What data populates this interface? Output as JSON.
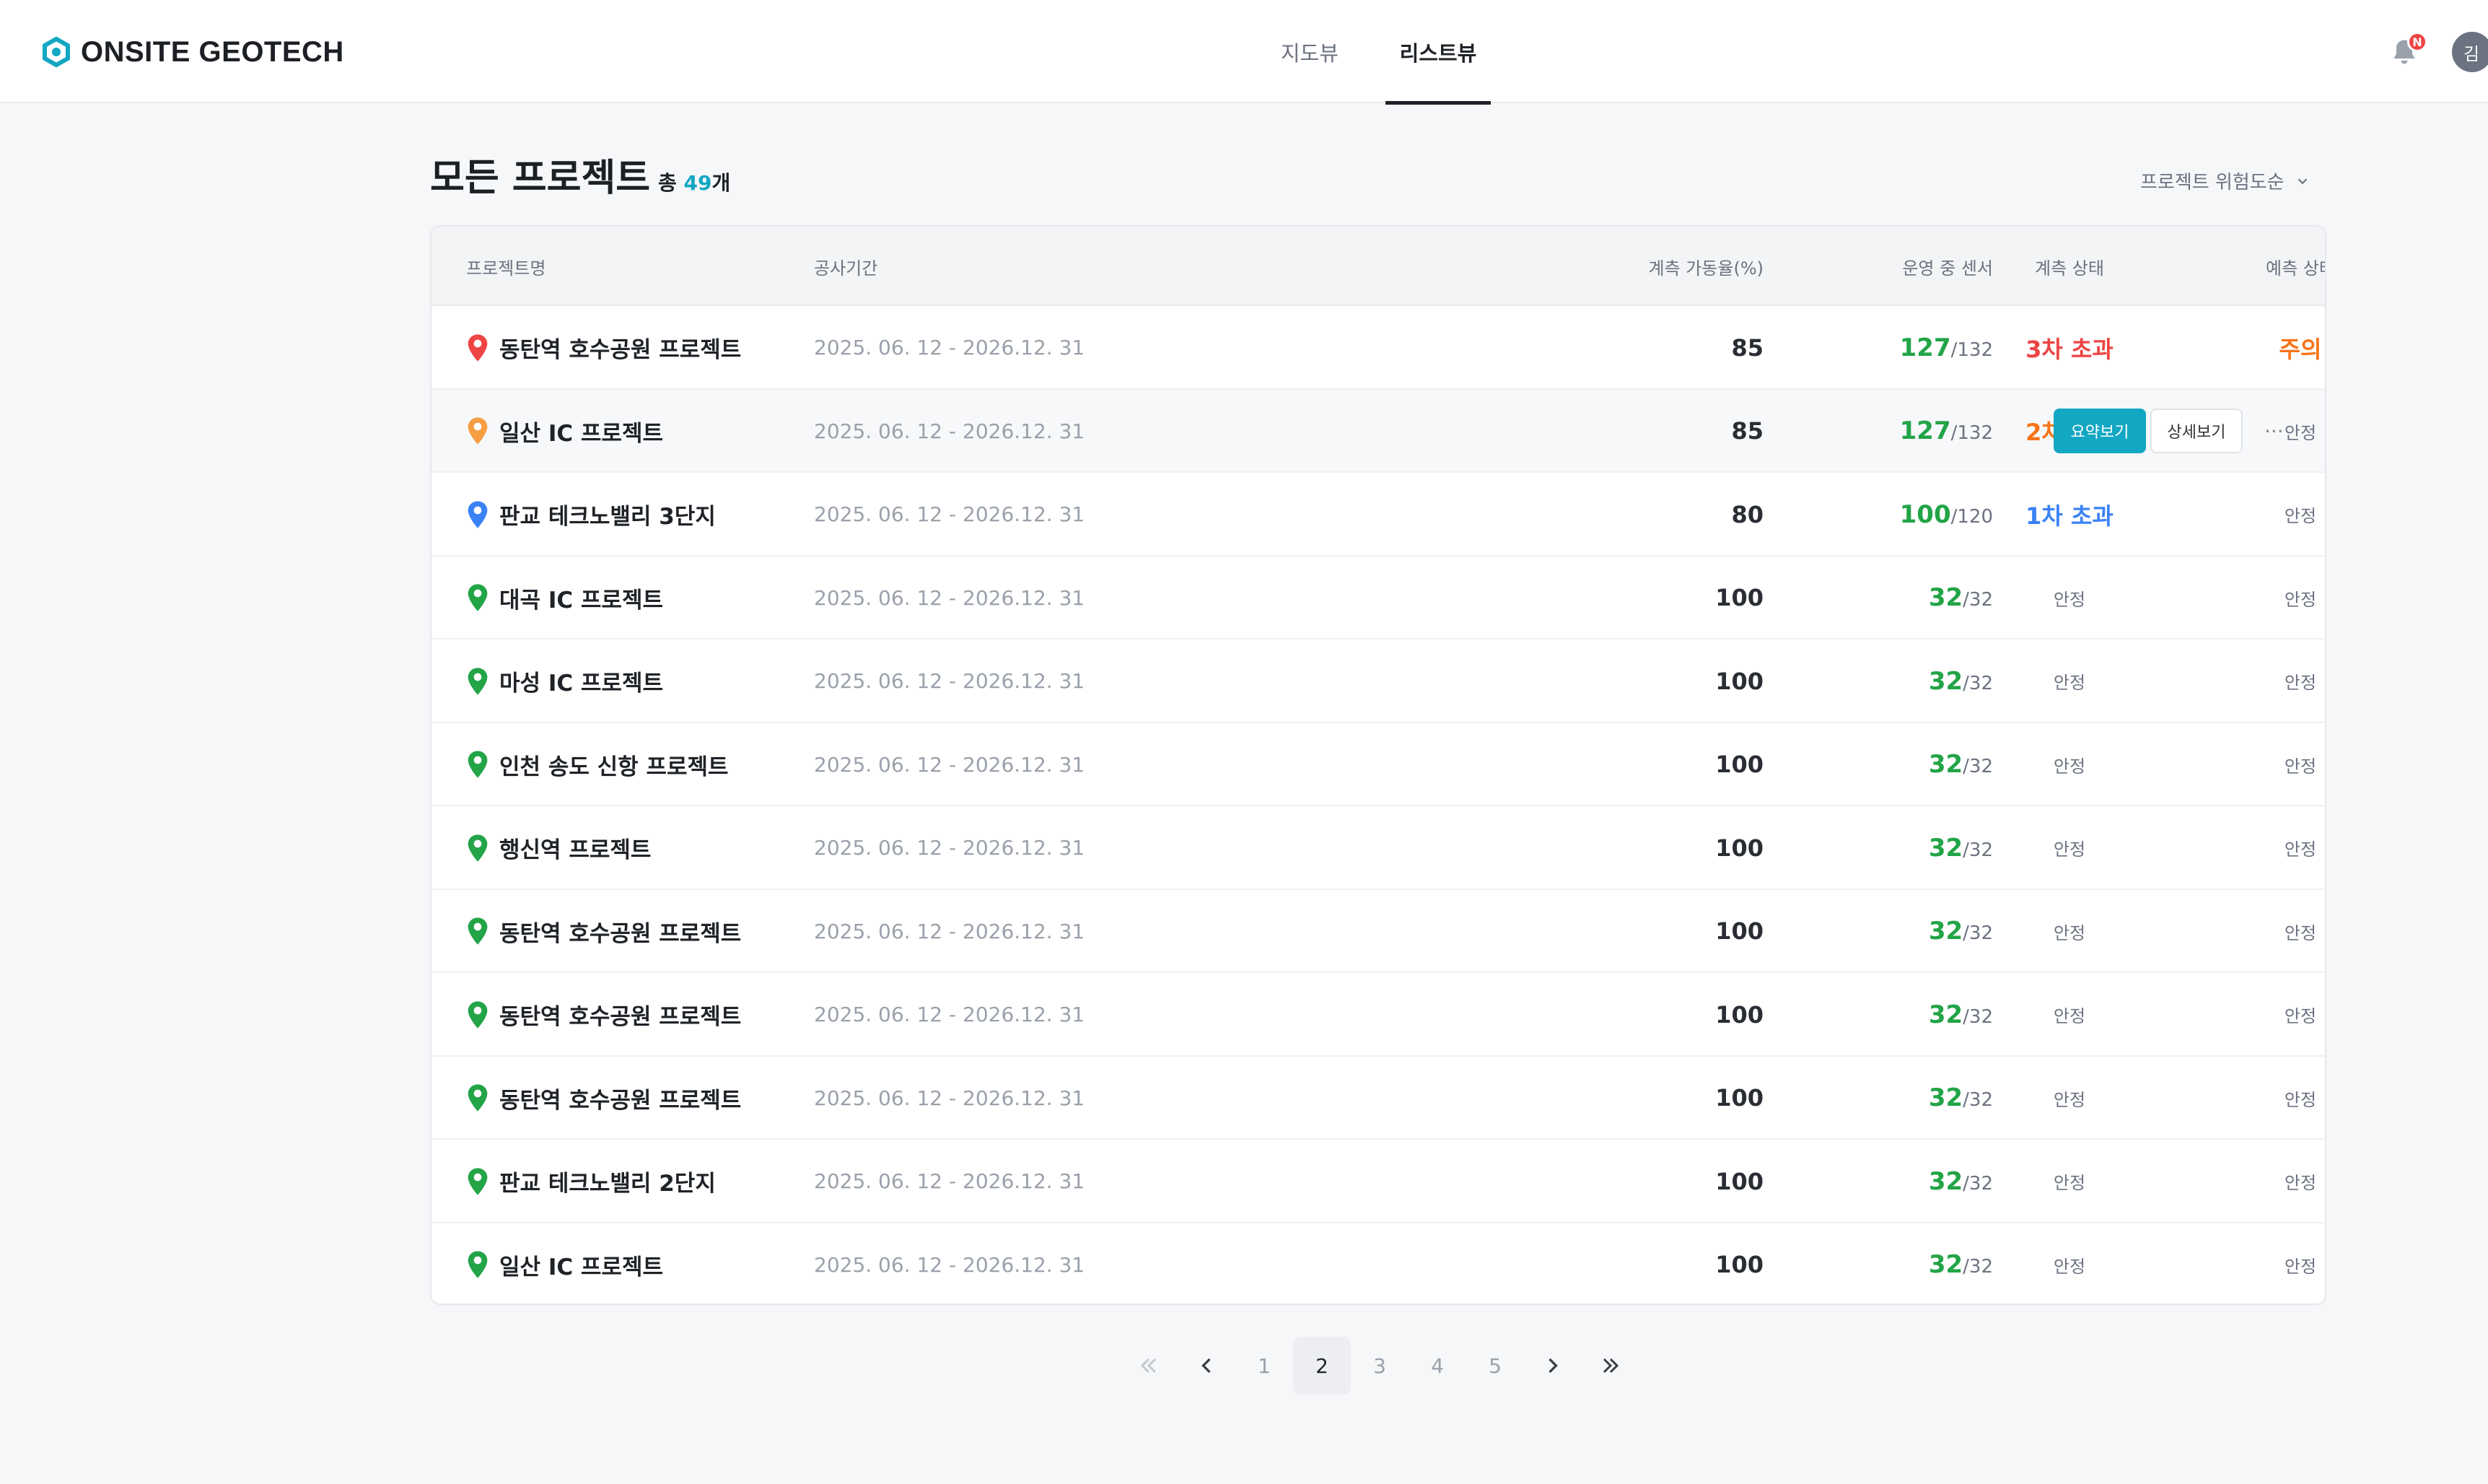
{
  "header": {
    "brand": "ONSITE GEOTECH",
    "tabs": [
      {
        "label": "지도뷰",
        "active": false
      },
      {
        "label": "리스트뷰",
        "active": true
      }
    ],
    "notification_badge": "N",
    "avatar_initial": "김"
  },
  "page": {
    "title": "모든 프로젝트",
    "total_prefix": "총 ",
    "total_count": "49",
    "total_suffix": "개",
    "sort_label": "프로젝트 위험도순"
  },
  "table": {
    "columns": [
      "프로젝트명",
      "공사기간",
      "계측 가동율(%)",
      "운영 중 센서",
      "계측 상태",
      "예측 상태"
    ],
    "rows": [
      {
        "name": "동탄역 호수공원 프로젝트",
        "pin_color": "#ef4444",
        "period": "2025. 06. 12 - 2026.12. 31",
        "rate": "85",
        "sensor_active": "127",
        "sensor_total": "/132",
        "measure_status": "3차 초과",
        "measure_color": "#ef4444",
        "predict_status": "주의",
        "predict_color": "#f97316"
      },
      {
        "name": "일산 IC 프로젝트",
        "pin_color": "#f59e42",
        "period": "2025. 06. 12 - 2026.12. 31",
        "rate": "85",
        "sensor_active": "127",
        "sensor_total": "/132",
        "measure_status": "2차 초과",
        "measure_color": "#f97316",
        "predict_status": "안정",
        "predict_color": "#6b7280"
      },
      {
        "name": "판교 테크노밸리 3단지",
        "pin_color": "#3b82f6",
        "period": "2025. 06. 12 - 2026.12. 31",
        "rate": "80",
        "sensor_active": "100",
        "sensor_total": "/120",
        "measure_status": "1차 초과",
        "measure_color": "#3b82f6",
        "predict_status": "안정",
        "predict_color": "#6b7280"
      },
      {
        "name": "대곡 IC 프로젝트",
        "pin_color": "#22a447",
        "period": "2025. 06. 12 - 2026.12. 31",
        "rate": "100",
        "sensor_active": "32",
        "sensor_total": "/32",
        "measure_status": "안정",
        "measure_color": "#6b7280",
        "predict_status": "안정",
        "predict_color": "#6b7280"
      },
      {
        "name": "마성 IC 프로젝트",
        "pin_color": "#22a447",
        "period": "2025. 06. 12 - 2026.12. 31",
        "rate": "100",
        "sensor_active": "32",
        "sensor_total": "/32",
        "measure_status": "안정",
        "measure_color": "#6b7280",
        "predict_status": "안정",
        "predict_color": "#6b7280"
      },
      {
        "name": "인천 송도 신항 프로젝트",
        "pin_color": "#22a447",
        "period": "2025. 06. 12 - 2026.12. 31",
        "rate": "100",
        "sensor_active": "32",
        "sensor_total": "/32",
        "measure_status": "안정",
        "measure_color": "#6b7280",
        "predict_status": "안정",
        "predict_color": "#6b7280"
      },
      {
        "name": "행신역 프로젝트",
        "pin_color": "#22a447",
        "period": "2025. 06. 12 - 2026.12. 31",
        "rate": "100",
        "sensor_active": "32",
        "sensor_total": "/32",
        "measure_status": "안정",
        "measure_color": "#6b7280",
        "predict_status": "안정",
        "predict_color": "#6b7280"
      },
      {
        "name": "동탄역 호수공원 프로젝트",
        "pin_color": "#22a447",
        "period": "2025. 06. 12 - 2026.12. 31",
        "rate": "100",
        "sensor_active": "32",
        "sensor_total": "/32",
        "measure_status": "안정",
        "measure_color": "#6b7280",
        "predict_status": "안정",
        "predict_color": "#6b7280"
      },
      {
        "name": "동탄역 호수공원 프로젝트",
        "pin_color": "#22a447",
        "period": "2025. 06. 12 - 2026.12. 31",
        "rate": "100",
        "sensor_active": "32",
        "sensor_total": "/32",
        "measure_status": "안정",
        "measure_color": "#6b7280",
        "predict_status": "안정",
        "predict_color": "#6b7280"
      },
      {
        "name": "동탄역 호수공원 프로젝트",
        "pin_color": "#22a447",
        "period": "2025. 06. 12 - 2026.12. 31",
        "rate": "100",
        "sensor_active": "32",
        "sensor_total": "/32",
        "measure_status": "안정",
        "measure_color": "#6b7280",
        "predict_status": "안정",
        "predict_color": "#6b7280"
      },
      {
        "name": "판교 테크노밸리 2단지",
        "pin_color": "#22a447",
        "period": "2025. 06. 12 - 2026.12. 31",
        "rate": "100",
        "sensor_active": "32",
        "sensor_total": "/32",
        "measure_status": "안정",
        "measure_color": "#6b7280",
        "predict_status": "안정",
        "predict_color": "#6b7280"
      },
      {
        "name": "일산 IC 프로젝트",
        "pin_color": "#22a447",
        "period": "2025. 06. 12 - 2026.12. 31",
        "rate": "100",
        "sensor_active": "32",
        "sensor_total": "/32",
        "measure_status": "안정",
        "measure_color": "#6b7280",
        "predict_status": "안정",
        "predict_color": "#6b7280"
      }
    ],
    "row_actions": {
      "summary_label": "요약보기",
      "detail_label": "상세보기",
      "more_label": "···"
    }
  },
  "pagination": {
    "pages": [
      "1",
      "2",
      "3",
      "4",
      "5"
    ],
    "current": "2"
  },
  "colors": {
    "accent": "#12a7c2",
    "sensor_green": "#22a447"
  }
}
